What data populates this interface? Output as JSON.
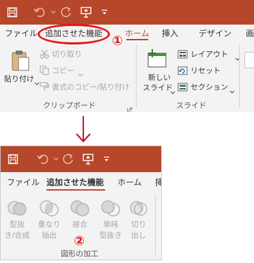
{
  "top": {
    "tabs": {
      "file": "ファイル",
      "added_features": "追加させた機能",
      "home": "ホーム",
      "insert": "挿入",
      "design": "デザイン",
      "more": "画"
    },
    "annotation_number": "①",
    "clipboard": {
      "paste": "貼り付け",
      "cut": "切り取り",
      "copy": "コピー",
      "format_painter": "書式のコピー/貼り付け",
      "group_label": "クリップボード"
    },
    "slides": {
      "new_slide_line1": "新しい",
      "new_slide_line2": "スライド",
      "layout": "レイアウト",
      "reset": "リセット",
      "section": "セクション",
      "group_label": "スライド"
    }
  },
  "bottom": {
    "tabs": {
      "file": "ファイル",
      "added_features": "追加させた機能",
      "home": "ホーム",
      "insert": "挿入"
    },
    "shape_buttons": [
      {
        "line1": "型抜",
        "line2": "き/合成"
      },
      {
        "line1": "重なり",
        "line2": "抽出"
      },
      {
        "line1": "接合",
        "line2": ""
      },
      {
        "line1": "単純",
        "line2": "型抜き"
      },
      {
        "line1": "切り",
        "line2": "出し"
      }
    ],
    "annotation_number": "②",
    "group_label": "図形の加工"
  },
  "colors": {
    "titlebar": "#b7472a",
    "accent": "#b7472a",
    "annotation": "#e8121a",
    "ribbon_bg": "#f3f3f3"
  }
}
